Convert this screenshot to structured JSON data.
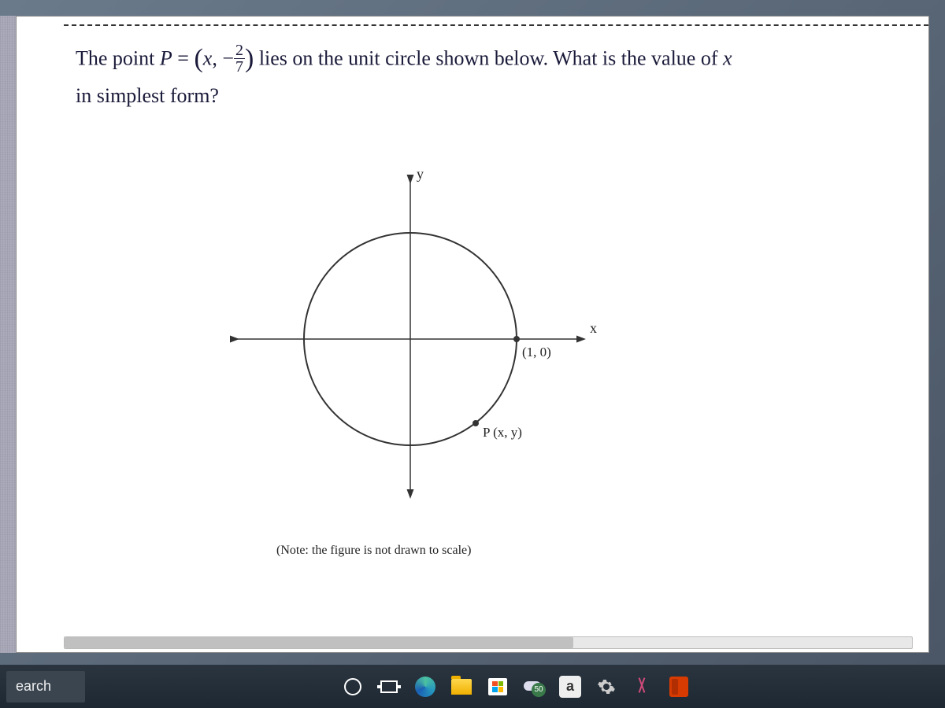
{
  "question": {
    "prefix": "The point ",
    "P": "P",
    "equals": " = ",
    "lparen": "(",
    "xvar": "x",
    "comma": ",  −",
    "frac_num": "2",
    "frac_den": "7",
    "rparen": ")",
    "mid": " lies on the unit circle shown below. What is the value of ",
    "xvar2": "x",
    "tail": " in simplest form?"
  },
  "diagram": {
    "y_label": "y",
    "x_label": "x",
    "point_10": "(1, 0)",
    "point_P": "P (x, y)"
  },
  "note": "(Note: the figure is not drawn to scale)",
  "taskbar": {
    "search": "earch",
    "weather_temp": "50",
    "amazon": "a"
  }
}
